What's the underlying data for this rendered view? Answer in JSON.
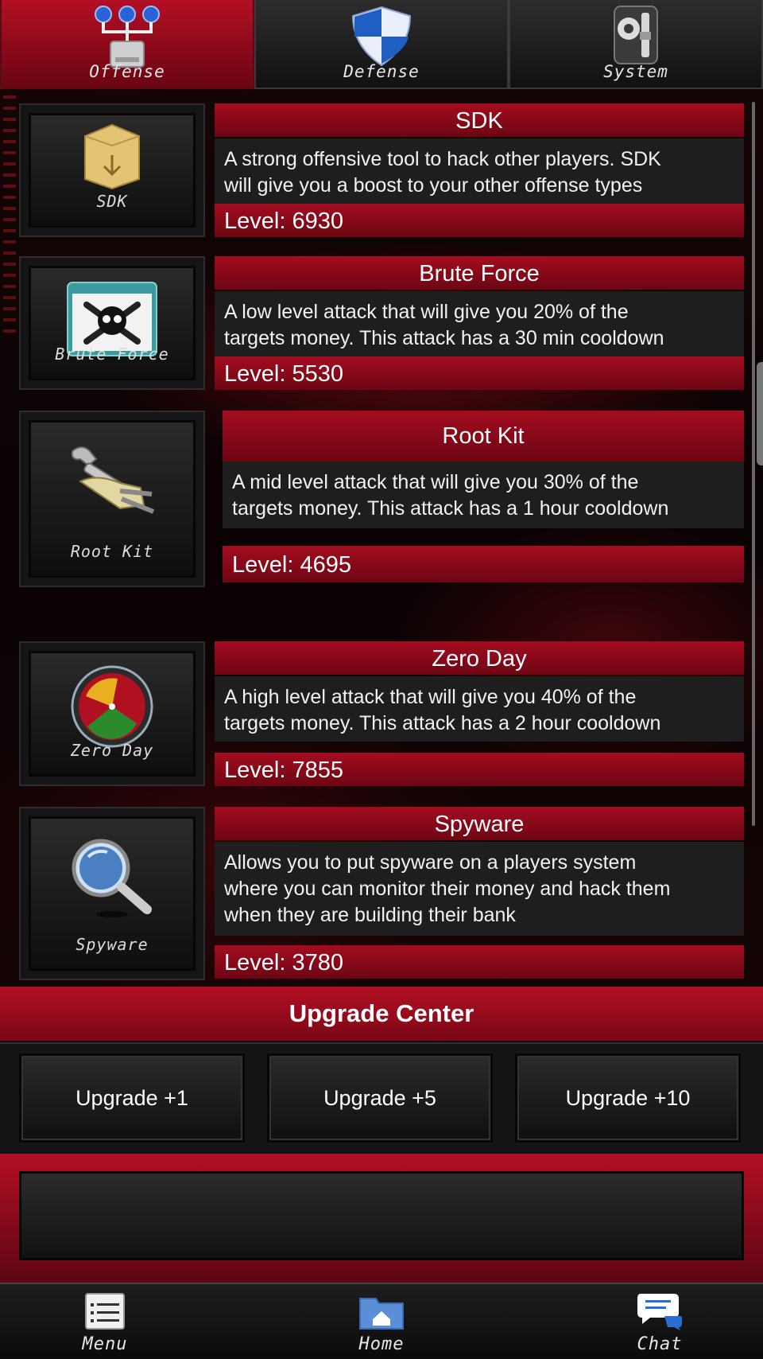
{
  "tabs": [
    {
      "label": "Offense",
      "icon": "network-drive-icon",
      "active": true
    },
    {
      "label": "Defense",
      "icon": "shield-icon",
      "active": false
    },
    {
      "label": "System",
      "icon": "gear-switch-icon",
      "active": false
    }
  ],
  "items": [
    {
      "name": "SDK",
      "icon_label": "SDK",
      "icon": "package-box-icon",
      "desc_lines": [
        "A strong offensive tool to hack other players. SDK",
        "will give you a boost to your other offense types"
      ],
      "level": "Level: 6930"
    },
    {
      "name": "Brute Force",
      "icon_label": "Brute Force",
      "icon": "skull-crossbones-window-icon",
      "desc_lines": [
        "A low level attack that will give you 20% of the",
        "targets money. This attack has a 30 min cooldown"
      ],
      "level": "Level: 5530"
    },
    {
      "name": "Root Kit",
      "icon_label": "Root Kit",
      "icon": "wrench-tools-icon",
      "desc_lines": [
        "A mid level attack that will give you 30% of the",
        "targets money. This attack has a 1 hour cooldown"
      ],
      "level": "Level: 4695"
    },
    {
      "name": "Zero Day",
      "icon_label": "Zero Day",
      "icon": "radar-scope-icon",
      "desc_lines": [
        "A high level attack that will give you 40% of the",
        "targets money. This attack has a 2 hour cooldown"
      ],
      "level": "Level: 7855"
    },
    {
      "name": "Spyware",
      "icon_label": "Spyware",
      "icon": "magnifying-glass-icon",
      "desc_lines": [
        "Allows you to put spyware on a players system",
        "where you can monitor their money and hack them",
        "when they are building their bank"
      ],
      "level": "Level: 3780"
    }
  ],
  "upgrade": {
    "title": "Upgrade Center",
    "buttons": [
      "Upgrade +1",
      "Upgrade +5",
      "Upgrade +10"
    ]
  },
  "bottom_nav": [
    {
      "label": "Menu",
      "icon": "document-list-icon"
    },
    {
      "label": "Home",
      "icon": "home-folder-icon"
    },
    {
      "label": "Chat",
      "icon": "chat-bubbles-icon"
    }
  ],
  "colors": {
    "accent_red": "#a30c1f",
    "dark_red": "#6d0614",
    "panel": "#1e1e1e"
  }
}
